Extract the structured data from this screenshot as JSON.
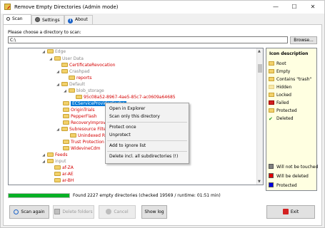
{
  "window": {
    "title": "Remove Empty Directories (Admin mode)",
    "min_label": "—",
    "max_label": "☐",
    "close_label": "✕"
  },
  "tabs": [
    {
      "label": "Scan",
      "icon": "search-icon",
      "active": true
    },
    {
      "label": "Settings",
      "icon": "gear-icon",
      "active": false
    },
    {
      "label": "About",
      "icon": "info-icon",
      "active": false
    }
  ],
  "directory": {
    "label": "Please choose a directory to scan:",
    "value": "C:\\",
    "browse_label": "Browse..."
  },
  "tree": {
    "nodes": [
      {
        "label": "Edge",
        "kind": "gray"
      },
      {
        "label": "User Data",
        "kind": "gray"
      },
      {
        "label": "CertificateRevocation",
        "kind": "red"
      },
      {
        "label": "Crashpad",
        "kind": "gray"
      },
      {
        "label": "reports",
        "kind": "red"
      },
      {
        "label": "Default",
        "kind": "gray"
      },
      {
        "label": "blob_storage",
        "kind": "gray"
      },
      {
        "label": "95c08a52-8967-4ae5-85c7-ac0609a64685",
        "kind": "red"
      },
      {
        "label": "ECServiceProviderCache",
        "kind": "selected"
      },
      {
        "label": "OriginTrials",
        "kind": "red"
      },
      {
        "label": "PepperFlash",
        "kind": "red"
      },
      {
        "label": "RecoveryImproved",
        "kind": "red"
      },
      {
        "label": "Subresource Filter",
        "kind": "red"
      },
      {
        "label": "Unindexed Rules",
        "kind": "red"
      },
      {
        "label": "Trust Protection Lists",
        "kind": "red"
      },
      {
        "label": "WidevineCdm",
        "kind": "red"
      },
      {
        "label": "Feeds",
        "kind": "red"
      },
      {
        "label": "input",
        "kind": "gray"
      },
      {
        "label": "af-ZA",
        "kind": "red"
      },
      {
        "label": "ar-AE",
        "kind": "red"
      },
      {
        "label": "ar-BH",
        "kind": "red"
      }
    ]
  },
  "context_menu": {
    "items": [
      "Open in Explorer",
      "Scan only this directory",
      "Protect once",
      "Unprotect",
      "Add to ignore list",
      "Delete incl. all subdirectories (!)"
    ]
  },
  "legend": {
    "title": "Icon description",
    "icons": [
      "Root",
      "Empty",
      "Contains \"trash\"",
      "Hidden",
      "Locked",
      "Failed",
      "Protected",
      "Deleted"
    ],
    "colors": [
      {
        "label": "Will not be touched",
        "color": "#808080"
      },
      {
        "label": "Will be deleted",
        "color": "#e00000"
      },
      {
        "label": "Protected",
        "color": "#0000e0"
      }
    ]
  },
  "status": {
    "progress_fraction": 1.0,
    "text": "Found 2227 empty directories (checked 19569 / runtime: 01:51 min)"
  },
  "buttons": {
    "scan": "Scan again",
    "delete": "Delete folders",
    "cancel": "Cancel",
    "show_log": "Show log",
    "exit": "Exit"
  },
  "colors": {
    "accent": "#0078d7",
    "progress": "#06b025",
    "red_text": "#d40000"
  }
}
